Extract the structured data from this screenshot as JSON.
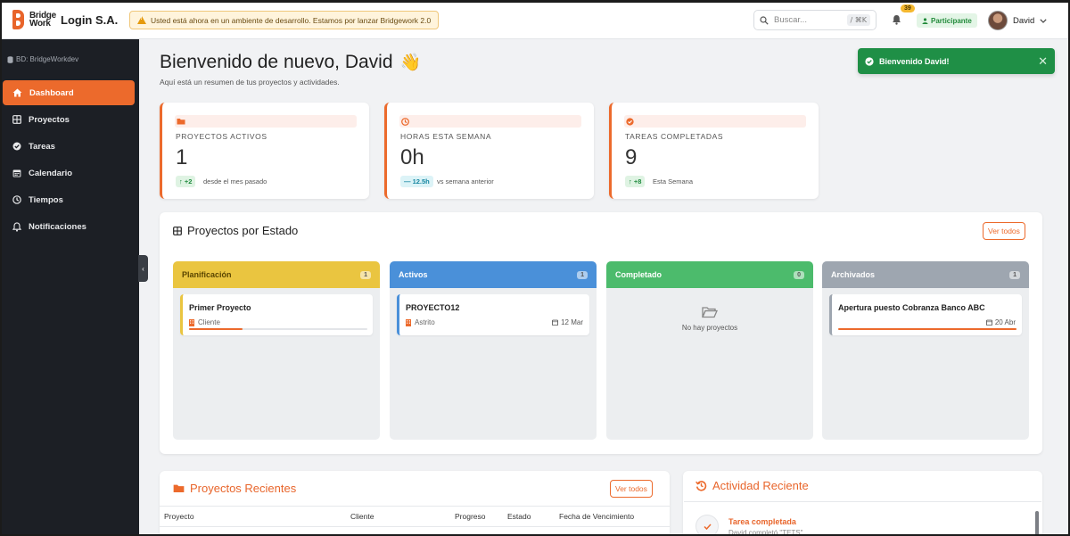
{
  "header": {
    "logo_line1": "Bridge",
    "logo_line2": "Work",
    "org_name": "Login S.A.",
    "dev_banner": "Usted está ahora en un ambiente de desarrollo. Estamos por lanzar Bridgework 2.0",
    "search_placeholder": "Buscar...",
    "search_shortcut": "/ ⌘K",
    "notification_count": "39",
    "role": "Participante",
    "user_name": "David"
  },
  "sidebar": {
    "db_label": "BD: BridgeWorkdev",
    "items": [
      {
        "label": "Dashboard",
        "icon": "home-icon"
      },
      {
        "label": "Proyectos",
        "icon": "grid-icon"
      },
      {
        "label": "Tareas",
        "icon": "check-circle-icon"
      },
      {
        "label": "Calendario",
        "icon": "calendar-icon"
      },
      {
        "label": "Tiempos",
        "icon": "clock-icon"
      },
      {
        "label": "Notificaciones",
        "icon": "bell-icon"
      }
    ]
  },
  "welcome": {
    "title": "Bienvenido de nuevo, David",
    "emoji": "👋",
    "subtitle": "Aquí está un resumen de tus proyectos y actividades."
  },
  "toast": {
    "message": "Bienvenido David!",
    "close": "✕"
  },
  "stats": [
    {
      "label": "PROYECTOS ACTIVOS",
      "value": "1",
      "delta": "↑ +2",
      "delta_text": "desde el mes pasado",
      "icon": "folder-icon"
    },
    {
      "label": "HORAS ESTA SEMANA",
      "value": "0h",
      "delta": "— 12.5h",
      "delta_text": "vs semana anterior",
      "icon": "clock-icon"
    },
    {
      "label": "TAREAS COMPLETADAS",
      "value": "9",
      "delta": "↑ +8",
      "delta_text": "Esta Semana",
      "icon": "check-circle-icon"
    }
  ],
  "projects_by_status": {
    "title": "Proyectos por Estado",
    "view_all": "Ver todos",
    "columns": [
      {
        "label": "Planificación",
        "count": "1",
        "color": "#eac540",
        "project": {
          "name": "Primer Proyecto",
          "client": "Cliente",
          "date": "",
          "progress": 0.3
        }
      },
      {
        "label": "Activos",
        "count": "1",
        "color": "#4a90d9",
        "project": {
          "name": "PROYECTO12",
          "client": "Astrito",
          "date": "12 Mar"
        }
      },
      {
        "label": "Completado",
        "count": "0",
        "color": "#4cbb6c",
        "empty_text": "No hay proyectos"
      },
      {
        "label": "Archivados",
        "count": "1",
        "color": "#9ea6b0",
        "project": {
          "name": "Apertura puesto Cobranza Banco ABC",
          "client": "",
          "date": "20 Abr",
          "progress": 1.0
        }
      }
    ]
  },
  "recent_projects": {
    "title": "Proyectos Recientes",
    "view_all": "Ver todos",
    "columns": [
      "Proyecto",
      "Cliente",
      "Progreso",
      "Estado",
      "Fecha de Vencimiento"
    ]
  },
  "recent_activity": {
    "title": "Actividad Reciente",
    "items": [
      {
        "title": "Tarea completada",
        "detail": "David completó \"TETS\""
      }
    ]
  },
  "colors": {
    "accent": "#ec6a2c",
    "sidebar_bg": "#1c1f25",
    "toast_bg": "#1f8f46"
  }
}
